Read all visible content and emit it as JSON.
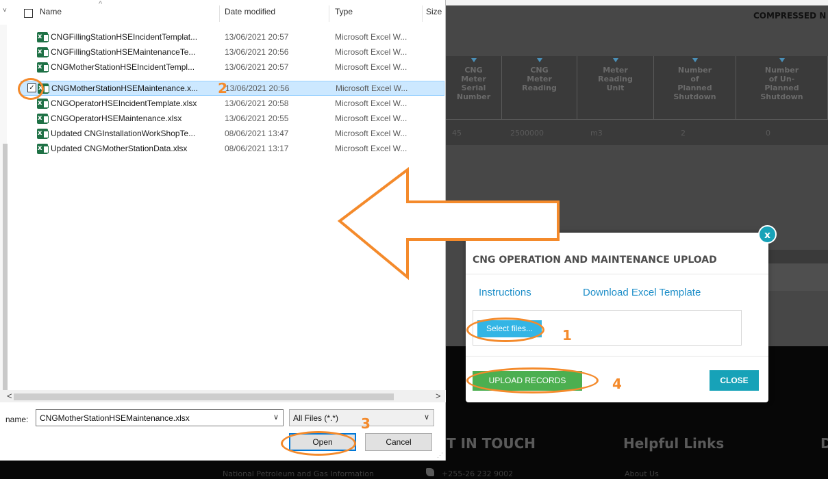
{
  "background": {
    "header_title": "COMPRESSED N",
    "table_headers": [
      "CNG\nMeter\nSerial\nNumber",
      "CNG\nMeter\nReading",
      "Meter\nReading\nUnit",
      "Number\nof\nPlanned\nShutdown",
      "Number\nof Un-\nPlanned\nShutdown"
    ],
    "table_row": [
      "45",
      "2500000",
      "m3",
      "2",
      "0"
    ],
    "footer": {
      "get_in_touch": "T IN TOUCH",
      "helpful_links": "Helpful Links",
      "d": "D",
      "org_text": "National Petroleum and Gas Information",
      "phone": "+255-26 232 9002",
      "about": "About Us"
    }
  },
  "file_dialog": {
    "columns": {
      "name": "Name",
      "date": "Date modified",
      "type": "Type",
      "size": "Size"
    },
    "files": [
      {
        "name": "CNGFillingStationHSEIncidentTemplat...",
        "date": "13/06/2021 20:57",
        "type": "Microsoft Excel W..."
      },
      {
        "name": "CNGFillingStationHSEMaintenanceTe...",
        "date": "13/06/2021 20:56",
        "type": "Microsoft Excel W..."
      },
      {
        "name": "CNGMotherStationHSEIncidentTempl...",
        "date": "13/06/2021 20:57",
        "type": "Microsoft Excel W..."
      },
      {
        "name": "CNGMotherStationHSEMaintenance.x...",
        "date": "13/06/2021 20:56",
        "type": "Microsoft Excel W..."
      },
      {
        "name": "CNGOperatorHSEIncidentTemplate.xlsx",
        "date": "13/06/2021 20:58",
        "type": "Microsoft Excel W..."
      },
      {
        "name": "CNGOperatorHSEMaintenance.xlsx",
        "date": "13/06/2021 20:55",
        "type": "Microsoft Excel W..."
      },
      {
        "name": "Updated CNGInstallationWorkShopTe...",
        "date": "08/06/2021 13:47",
        "type": "Microsoft Excel W..."
      },
      {
        "name": "Updated CNGMotherStationData.xlsx",
        "date": "08/06/2021 13:17",
        "type": "Microsoft Excel W..."
      }
    ],
    "selected_index": 3,
    "filename_label": "name:",
    "filename_value": "CNGMotherStationHSEMaintenance.xlsx",
    "filetype_value": "All Files (*.*)",
    "open_label": "Open",
    "cancel_label": "Cancel"
  },
  "modal": {
    "title": "CNG OPERATION AND MAINTENANCE UPLOAD",
    "instructions_link": "Instructions",
    "download_link": "Download Excel Template",
    "select_files_label": "Select files...",
    "upload_label": "UPLOAD RECORDS",
    "close_label": "CLOSE",
    "close_icon": "x"
  },
  "annotations": {
    "step1": "1",
    "step2": "2",
    "step3": "3",
    "step4": "4",
    "color": "#f48a2b"
  }
}
